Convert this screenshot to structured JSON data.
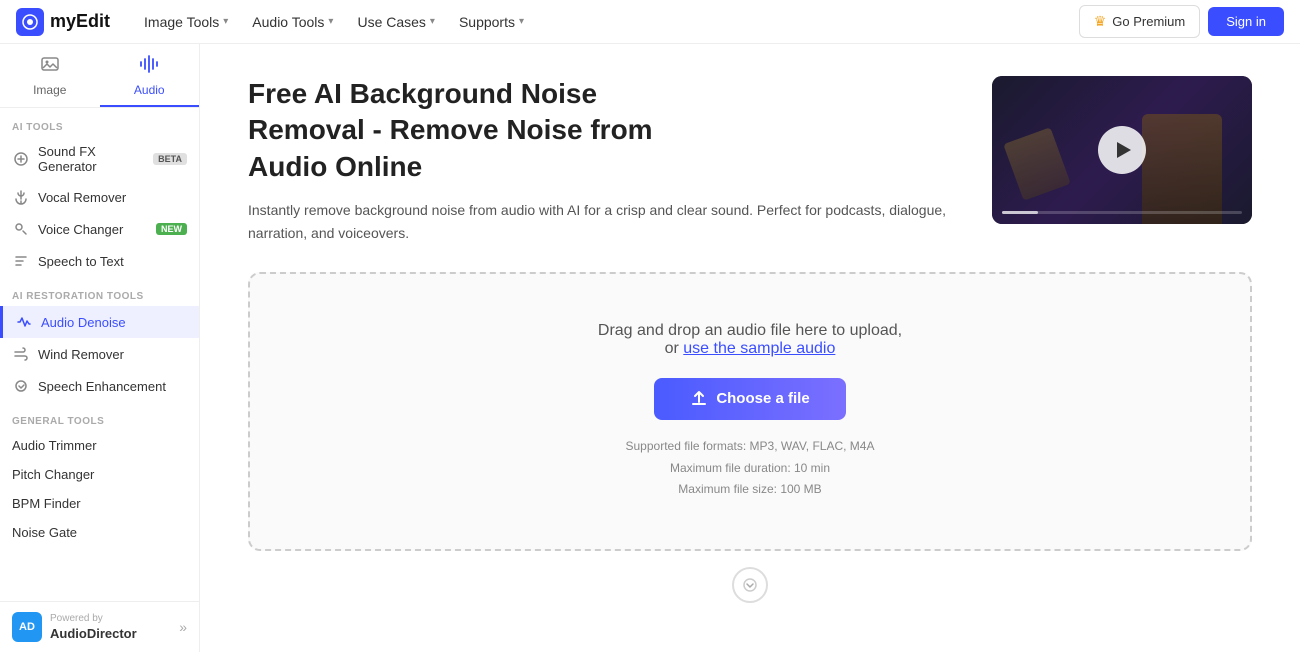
{
  "topnav": {
    "logo_icon": "M",
    "logo_text": "myEdit",
    "menu_items": [
      {
        "label": "Image Tools",
        "has_chevron": true
      },
      {
        "label": "Audio Tools",
        "has_chevron": true
      },
      {
        "label": "Use Cases",
        "has_chevron": true
      },
      {
        "label": "Supports",
        "has_chevron": true
      }
    ],
    "btn_premium": "Go Premium",
    "btn_signin": "Sign in"
  },
  "sidebar": {
    "tab_image": "Image",
    "tab_audio": "Audio",
    "section_ai_tools": "AI TOOLS",
    "items_ai": [
      {
        "label": "Sound FX Generator",
        "badge": "BETA",
        "badge_type": "beta"
      },
      {
        "label": "Vocal Remover",
        "badge": "",
        "badge_type": ""
      },
      {
        "label": "Voice Changer",
        "badge": "NEW",
        "badge_type": "new"
      },
      {
        "label": "Speech to Text",
        "badge": "",
        "badge_type": ""
      }
    ],
    "section_restoration": "AI RESTORATION TOOLS",
    "items_restoration": [
      {
        "label": "Audio Denoise",
        "active": true
      },
      {
        "label": "Wind Remover"
      },
      {
        "label": "Speech Enhancement"
      }
    ],
    "section_general": "GENERAL TOOLS",
    "items_general": [
      {
        "label": "Audio Trimmer"
      },
      {
        "label": "Pitch Changer"
      },
      {
        "label": "BPM Finder"
      },
      {
        "label": "Noise Gate"
      }
    ],
    "footer_powered_by": "Powered by",
    "footer_brand": "AudioDirector"
  },
  "hero": {
    "title_line1": "Free AI Background Noise",
    "title_line2": "Removal - Remove Noise from",
    "title_line3": "Audio Online",
    "description": "Instantly remove background noise from audio with AI for a crisp and clear sound. Perfect for podcasts, dialogue, narration, and voiceovers."
  },
  "upload": {
    "drag_text": "Drag and drop an audio file here to upload,",
    "or_text": "or",
    "sample_link": "use the sample audio",
    "btn_choose": "Choose a file",
    "info_formats": "Supported file formats: MP3, WAV, FLAC, M4A",
    "info_duration": "Maximum file duration: 10 min",
    "info_size": "Maximum file size: 100 MB"
  }
}
